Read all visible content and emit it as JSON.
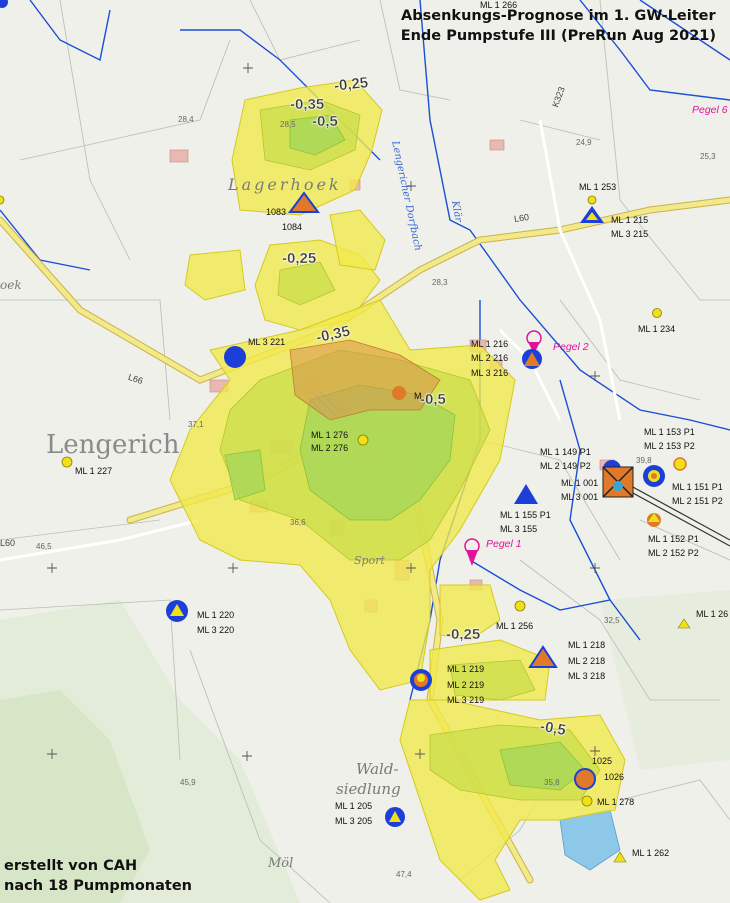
{
  "title": {
    "line1": "Absenkungs-Prognose im 1. GW-Leiter",
    "line2": "Ende Pumpstufe III (PreRun Aug 2021)"
  },
  "credit": {
    "line1": "erstellt von CAH",
    "line2": "nach 18 Pumpmonaten"
  },
  "places": {
    "lengerich": "Lengerich",
    "lagerhoek": "Lagerhoek",
    "wald_1": "Wald-",
    "wald_2": "siedlung",
    "moel": "Möl",
    "sport": "Sport",
    "bek": "oek",
    "dorfbach": "Lengericher Dorfbach",
    "klar": "Klär"
  },
  "roads": {
    "l66": "L66",
    "l60_left": "L60",
    "l60_right": "L60",
    "k323": "K323"
  },
  "elevations": {
    "e1": "28,4",
    "e2": "28,5",
    "e3": "28,3",
    "e4": "24,9",
    "e5": "25,3",
    "e6": "37,1",
    "e7": "36,6",
    "e8": "46,5",
    "e9": "39,8",
    "e10": "32,5",
    "e11": "45,9",
    "e12": "35,8",
    "e13": "47,4"
  },
  "contours": {
    "c1": "-0,25",
    "c2": "-0,35",
    "c3": "-0,5",
    "c4": "-0,25",
    "c5": "-0,35",
    "c6": "-0,5",
    "c7": "-0,25",
    "c8": "-0,5"
  },
  "pegel": {
    "p2": "Pegel 2",
    "p1": "Pegel 1",
    "p6": "Pegel 6"
  },
  "wells": {
    "w1083": "1083",
    "w1084": "1084",
    "ml1253": "ML 1 253",
    "ml1215": "ML 1 215",
    "ml3215": "ML 3 215",
    "ml1234": "ML 1 234",
    "ml3221": "ML 3 221",
    "ml1216": "ML 1 216",
    "ml2216": "ML 2 216",
    "ml3216": "ML 3 216",
    "ml1276": "ML 1 276",
    "ml2276": "ML 2 276",
    "ml1227": "ML 1 227",
    "ml1149p1": "ML 1 149 P1",
    "ml2149p2": "ML 2 149 P2",
    "ml1153p1": "ML 1 153 P1",
    "ml2153p2": "ML 2 153 P2",
    "ml1001": "ML 1 001",
    "ml3001": "ML 3 001",
    "ml1151p1": "ML 1 151 P1",
    "ml2151p2": "ML 2 151 P2",
    "ml1155p1": "ML 1 155 P1",
    "ml3155": "ML 3 155",
    "ml1152p1": "ML 1 152 P1",
    "ml2152p2": "ML 2 152 P2",
    "ml126x": "ML 1 26",
    "ml1220": "ML 1 220",
    "ml3220": "ML 3 220",
    "ml1256": "ML 1 256",
    "ml1218": "ML 1 218",
    "ml2218": "ML 2 218",
    "ml3218": "ML 3 218",
    "ml1219": "ML 1 219",
    "ml2219": "ML 2 219",
    "ml3219": "ML 3 219",
    "w1025": "1025",
    "w1026": "1026",
    "ml1278": "ML 1 278",
    "ml1205": "ML 1 205",
    "ml3205": "ML 3 205",
    "ml1262": "ML 1 262",
    "ml1266": "ML 1 266",
    "m_partial": "M"
  },
  "colors": {
    "drawdown_025": "#f2e94a",
    "drawdown_035": "#c8dd4a",
    "drawdown_05": "#a6d65a",
    "pump_zone": "#d9904a",
    "water": "#1a4fd6",
    "road": "#f3e88a",
    "well_blue": "#1c3fd9",
    "well_yellow": "#f0e01a",
    "well_orange": "#e07a2a",
    "pegel_magenta": "#e0139a"
  }
}
